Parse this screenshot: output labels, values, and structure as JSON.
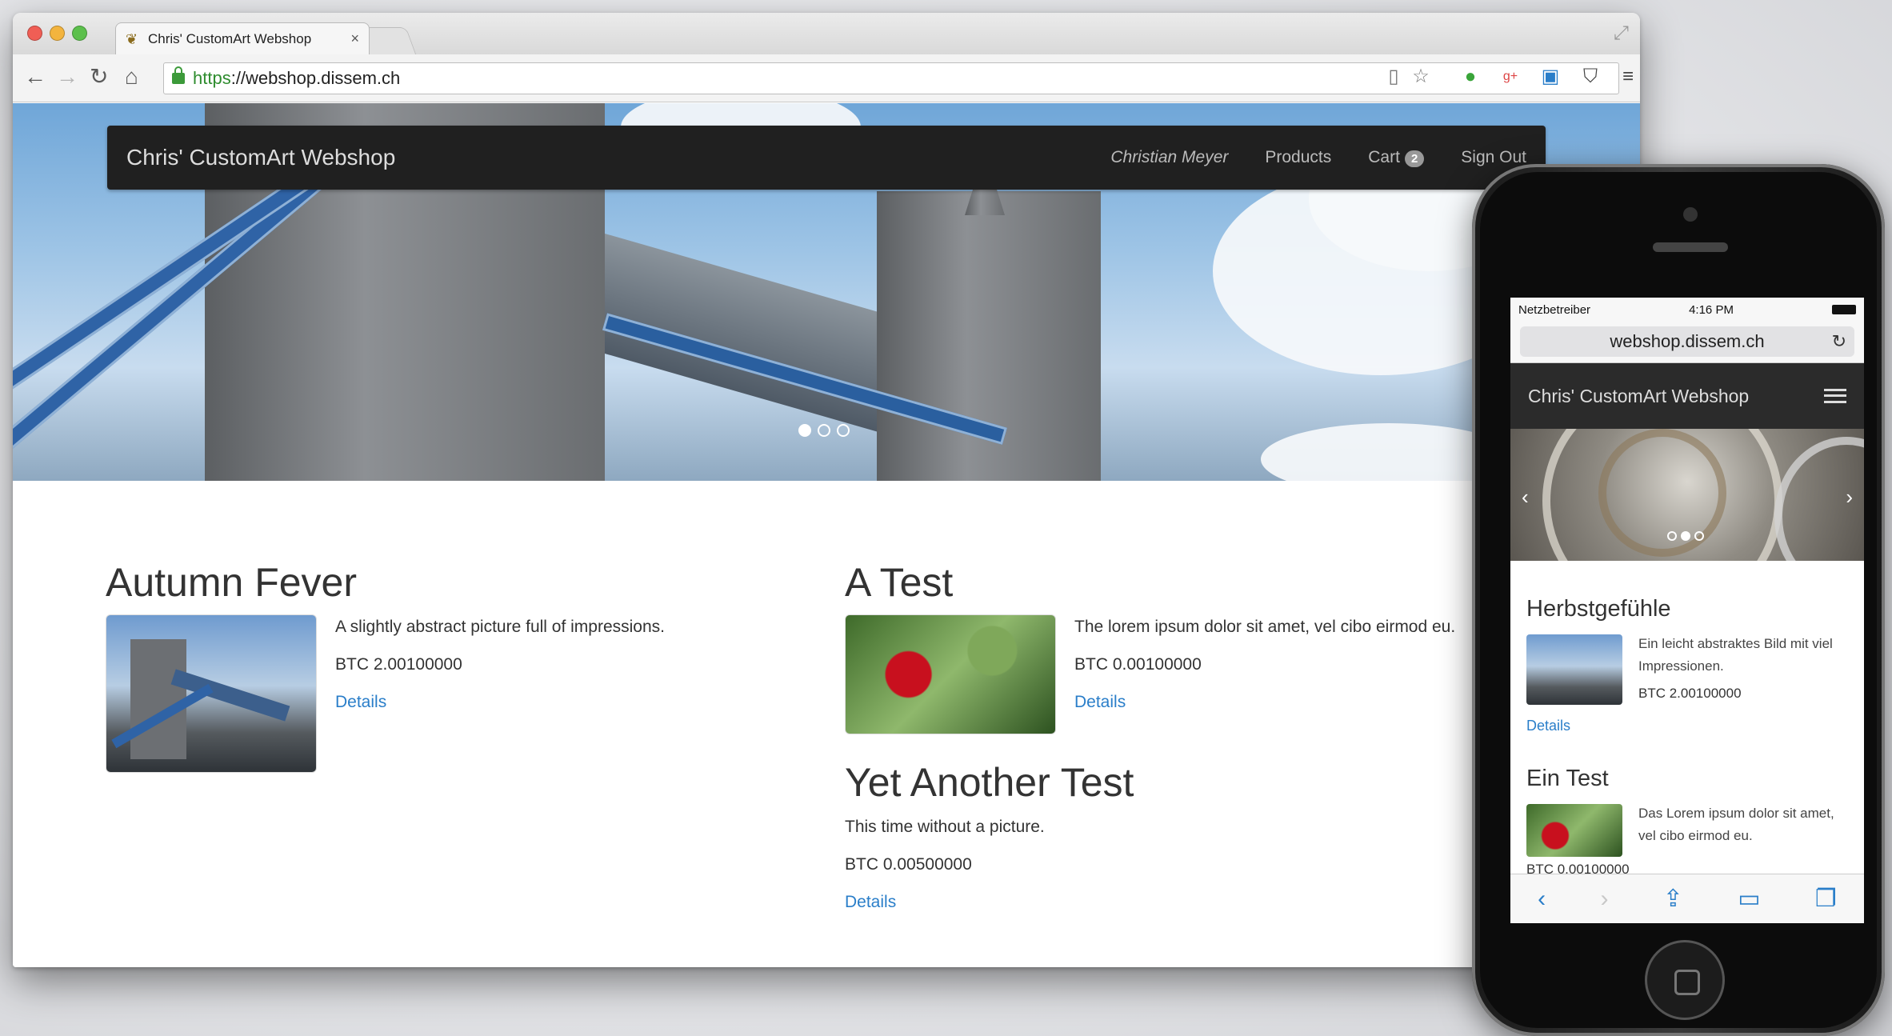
{
  "browser": {
    "tab_title": "Chris' CustomArt Webshop",
    "tab_close": "×",
    "url_scheme": "https",
    "url_rest": "://webshop.dissem.ch"
  },
  "site": {
    "brand": "Chris' CustomArt Webshop",
    "nav": {
      "user": "Christian Meyer",
      "products": "Products",
      "cart": "Cart",
      "cart_count": "2",
      "signout": "Sign Out"
    }
  },
  "products": [
    {
      "title": "Autumn Fever",
      "description": "A slightly abstract picture full of impressions.",
      "price": "BTC 2.00100000",
      "link": "Details"
    },
    {
      "title": "A Test",
      "description": "The lorem ipsum dolor sit amet, vel cibo eirmod eu.",
      "price": "BTC 0.00100000",
      "link": "Details"
    },
    {
      "title": "Yet Another Test",
      "description": "This time without a picture.",
      "price": "BTC 0.00500000",
      "link": "Details"
    }
  ],
  "phone": {
    "carrier": "Netzbetreiber",
    "time": "4:16 PM",
    "url": "webshop.dissem.ch",
    "brand": "Chris' CustomArt Webshop",
    "products": [
      {
        "title": "Herbstgefühle",
        "description": "Ein leicht abstraktes Bild mit viel Impressionen.",
        "price": "BTC 2.00100000",
        "link": "Details"
      },
      {
        "title": "Ein Test",
        "description": "Das Lorem ipsum dolor sit amet, vel cibo eirmod eu.",
        "price": "BTC 0.00100000"
      }
    ]
  },
  "colors": {
    "link": "#2a7ec9",
    "navbar": "#202020",
    "secure": "#2e8c2e"
  },
  "icons": [
    "back-arrow-icon",
    "forward-arrow-icon",
    "reload-icon",
    "home-icon",
    "lock-icon",
    "reader-icon",
    "star-icon",
    "extension-icon",
    "menu-icon",
    "hamburger-icon",
    "share-icon",
    "bookmarks-icon",
    "tabs-icon"
  ]
}
